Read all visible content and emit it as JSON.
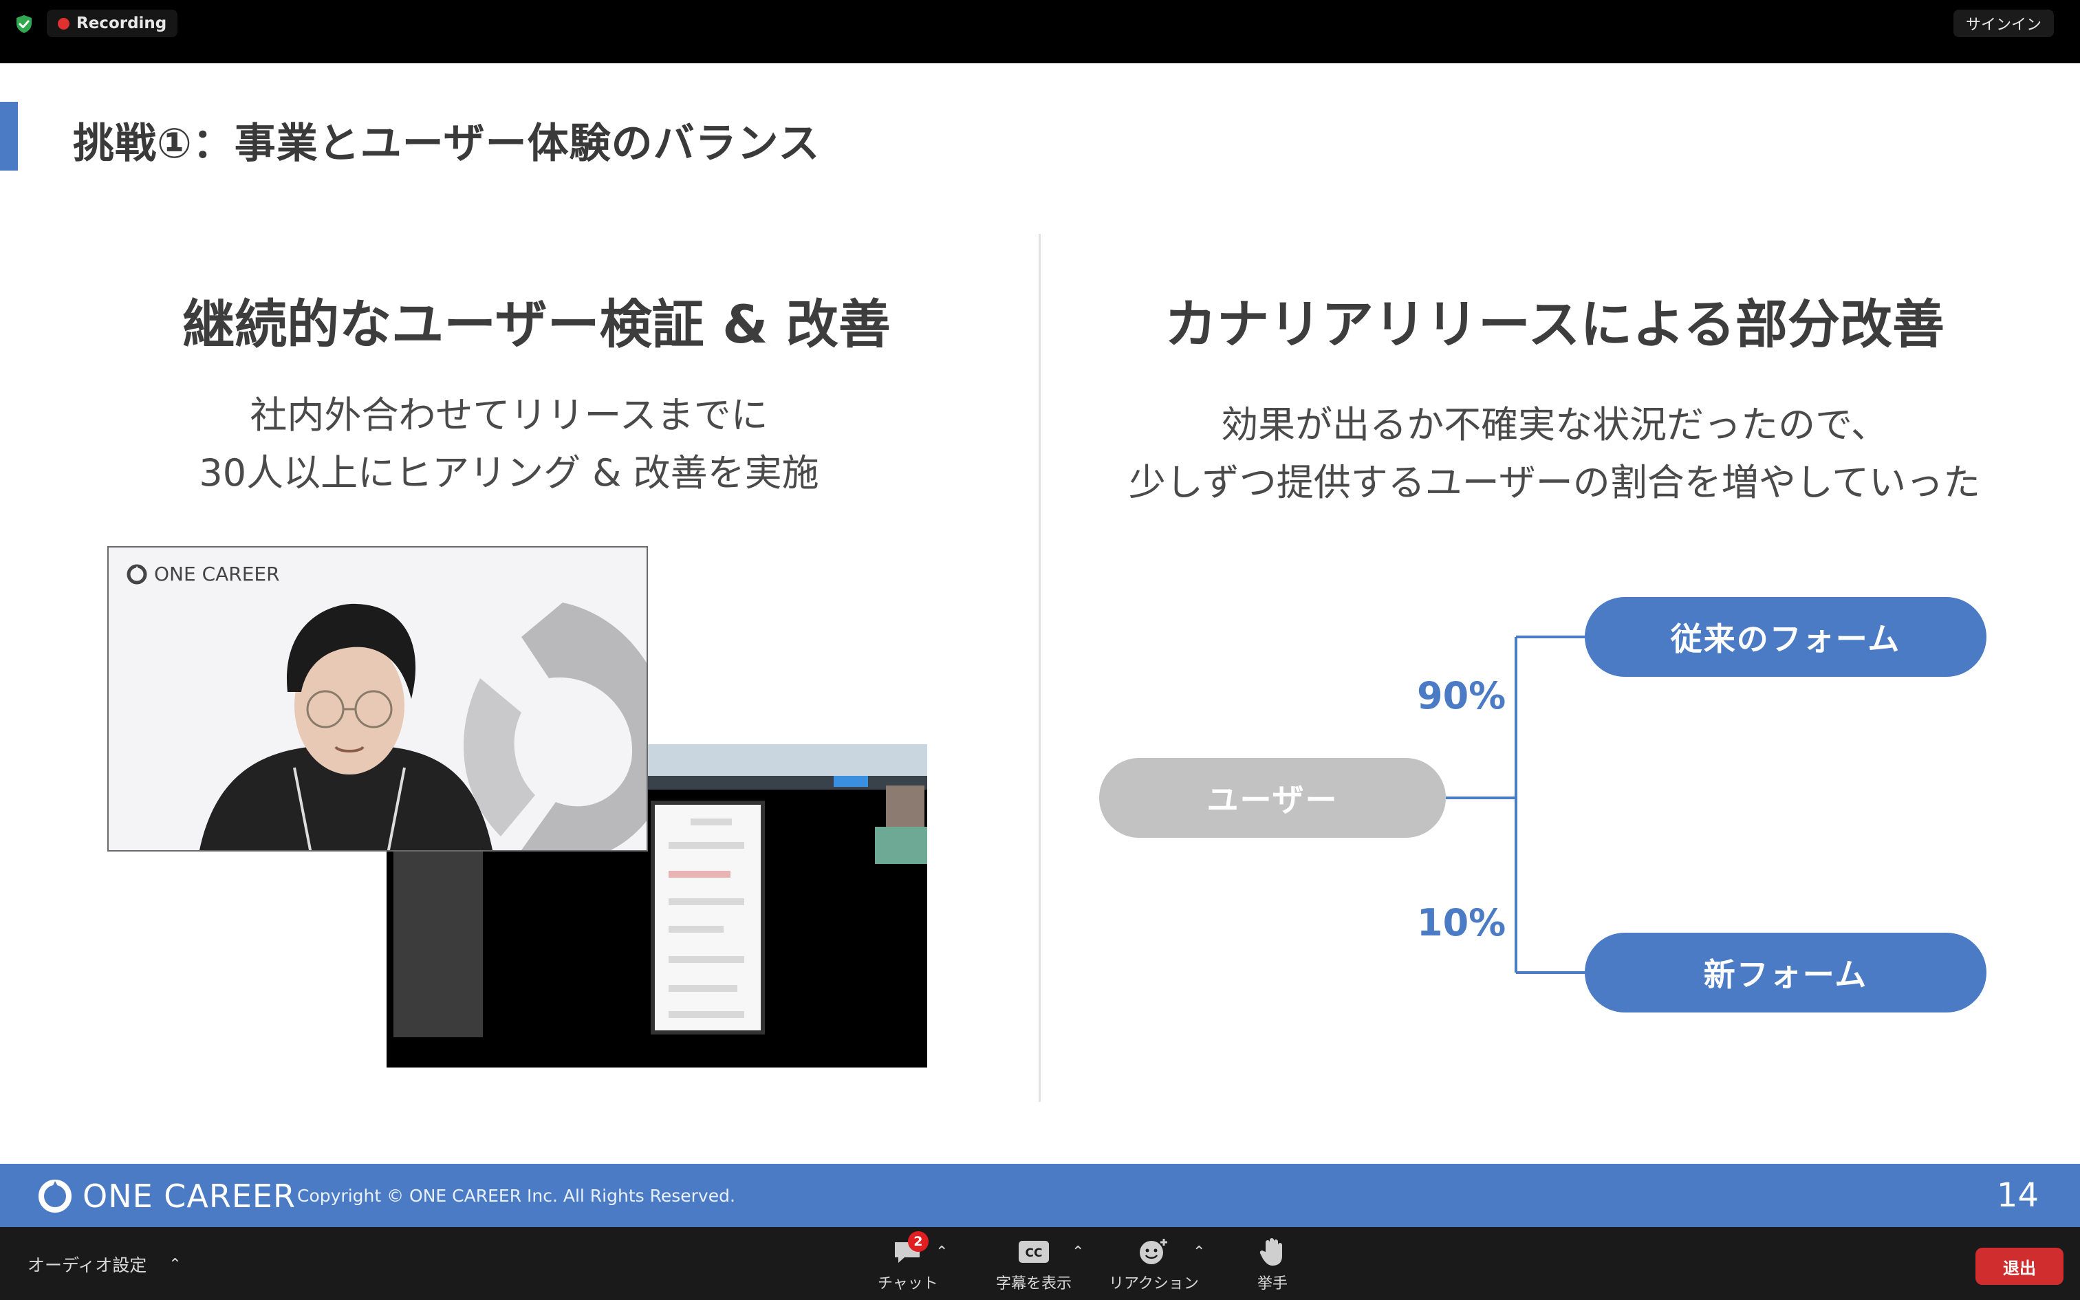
{
  "window": {
    "recording_label": "Recording",
    "signin_label": "サインイン"
  },
  "slide": {
    "title": "挑戦①：事業とユーザー体験のバランス",
    "left": {
      "heading": "継続的なユーザー検証 & 改善",
      "body_line1": "社内外合わせてリリースまでに",
      "body_line2": "30人以上にヒアリング & 改善を実施"
    },
    "right": {
      "heading": "カナリアリリースによる部分改善",
      "body_line1": "効果が出るか不確実な状況だったので、",
      "body_line2": "少しずつ提供するユーザーの割合を増やしていった"
    },
    "diagram": {
      "source_label": "ユーザー",
      "branch_top_label": "従来のフォーム",
      "branch_top_pct": "90%",
      "branch_bottom_label": "新フォーム",
      "branch_bottom_pct": "10%"
    },
    "camera_logo": "ONE CAREER",
    "footer": {
      "logo": "ONE CAREER",
      "copyright": "Copyright © ONE CAREER Inc. All Rights Reserved.",
      "page_number": "14"
    }
  },
  "toolbar": {
    "audio_label": "オーディオ設定",
    "chat_label": "チャット",
    "chat_badge": "2",
    "captions_label": "字幕を表示",
    "reaction_label": "リアクション",
    "raise_hand_label": "挙手",
    "leave_label": "退出"
  },
  "colors": {
    "accent": "#4a7bc4",
    "pill_gray": "#c2c2c2",
    "record_red": "#e03131",
    "leave_red": "#d02e2e"
  }
}
